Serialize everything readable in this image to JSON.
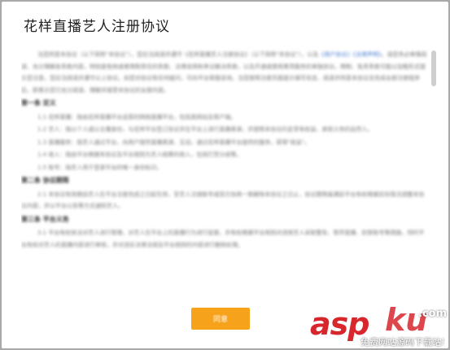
{
  "dialog": {
    "title": "花样直播艺人注册协议",
    "agree_label": "同意",
    "content": {
      "p1a": "当您同意本协议（以下简称\"本协议\"），您应当阅读并遵守《花样直播艺人注册协议》（以下简称\"本协议\"），以及",
      "p1link": "《用户协议》《法律声明》",
      "p1b": "。请您务必审慎阅读、充分理解各条款内容，特别是免除或者限制责任的条款、法律适用和争议解决条款，以及开通或使用某项服务的单独协议。限制、免责条款可能以加粗形式提示您注意。您应当阅读并遵守以上协议。如您对协议有任何疑问，可向平台客服咨询。当您按照注册页面提示填写信息、阅读并同意本协议且完成全部注册程序后，即表示您已充分阅读、理解并接受本协议的全部内容。",
      "h1": "第一条 定义",
      "i1": "1.1 花样直播：指由花样直播平台运营的网络直播平台，包括其网站及客户端。",
      "i2": "1.2 艺人：指以个人或以主播身份，与花样平台签订协议并在平台上进行直播表演，并按照本协议约定享有权益、承担义务的自然人。",
      "i3": "1.3 直播服务：指艺人通过平台，向用户提供直播表演、互动，通过花样直播平台提供的服务，获得\"收益\"。",
      "i4": "1.4 收入：指由平台根据本协议及平台规则为艺人结算的收入，包括打赏分成等。",
      "i5": "1.5 账号：指艺人用于登录平台的唯一身份标识。",
      "h2": "第二条 协议期限",
      "i6": "2.1 本协议有效期自艺人在平台注册完成之日起生效，至艺人注销账号或双方协商一致解除本协议之日止，协议期限届满前平台有权根据实际情况调整本协议内容，并以平台公告等方式通知艺人。",
      "h3": "第三条 平台义务",
      "i7": "3.1 平台有权依法对艺人进行管理，对艺人在平台上的直播行为进行监督，并有权根据平台规则对违规艺人采取警告、暂停直播、封禁账号等措施，同时平台有权对艺人的直播内容进行审核，并对违反法律法规及平台规则的内容进行删除处理。"
    }
  },
  "watermark": {
    "asp": "asp",
    "ku": "ku",
    "com": ".com",
    "subtitle": "免费网站源码下载站!"
  }
}
